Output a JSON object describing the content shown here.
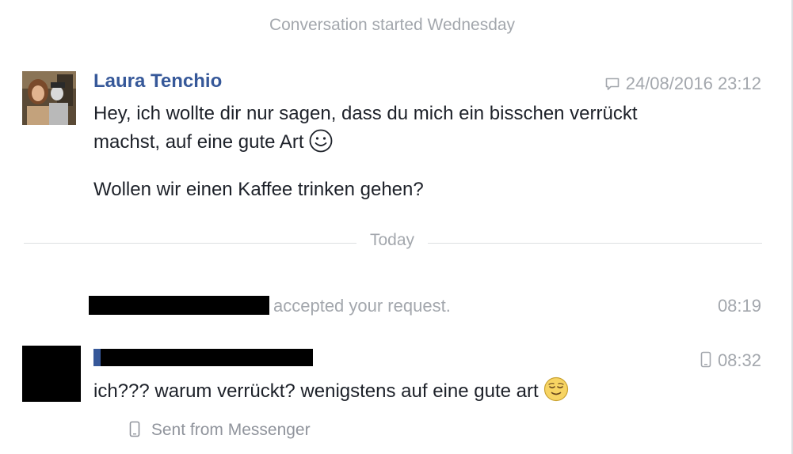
{
  "conversation": {
    "started_label": "Conversation started Wednesday",
    "today_label": "Today"
  },
  "messages": [
    {
      "sender": "Laura Tenchio",
      "timestamp": "24/08/2016 23:12",
      "source_icon": "chat-bubble-icon",
      "line1": "Hey, ich wollte dir nur sagen, dass du mich ein bisschen verrückt machst, auf eine gute Art",
      "line2": "Wollen wir einen Kaffee trinken gehen?"
    },
    {
      "timestamp": "08:32",
      "source_icon": "phone-icon",
      "text": "ich??? warum verrückt? wenigstens auf eine gute art"
    }
  ],
  "event": {
    "text": "accepted your request.",
    "timestamp": "08:19"
  },
  "footer": {
    "sent_from": "Sent from Messenger",
    "icon": "phone-icon"
  },
  "colors": {
    "name_link": "#365899",
    "meta_gray": "#a3a7ad",
    "text": "#1d2129",
    "divider": "#dddfe2"
  }
}
